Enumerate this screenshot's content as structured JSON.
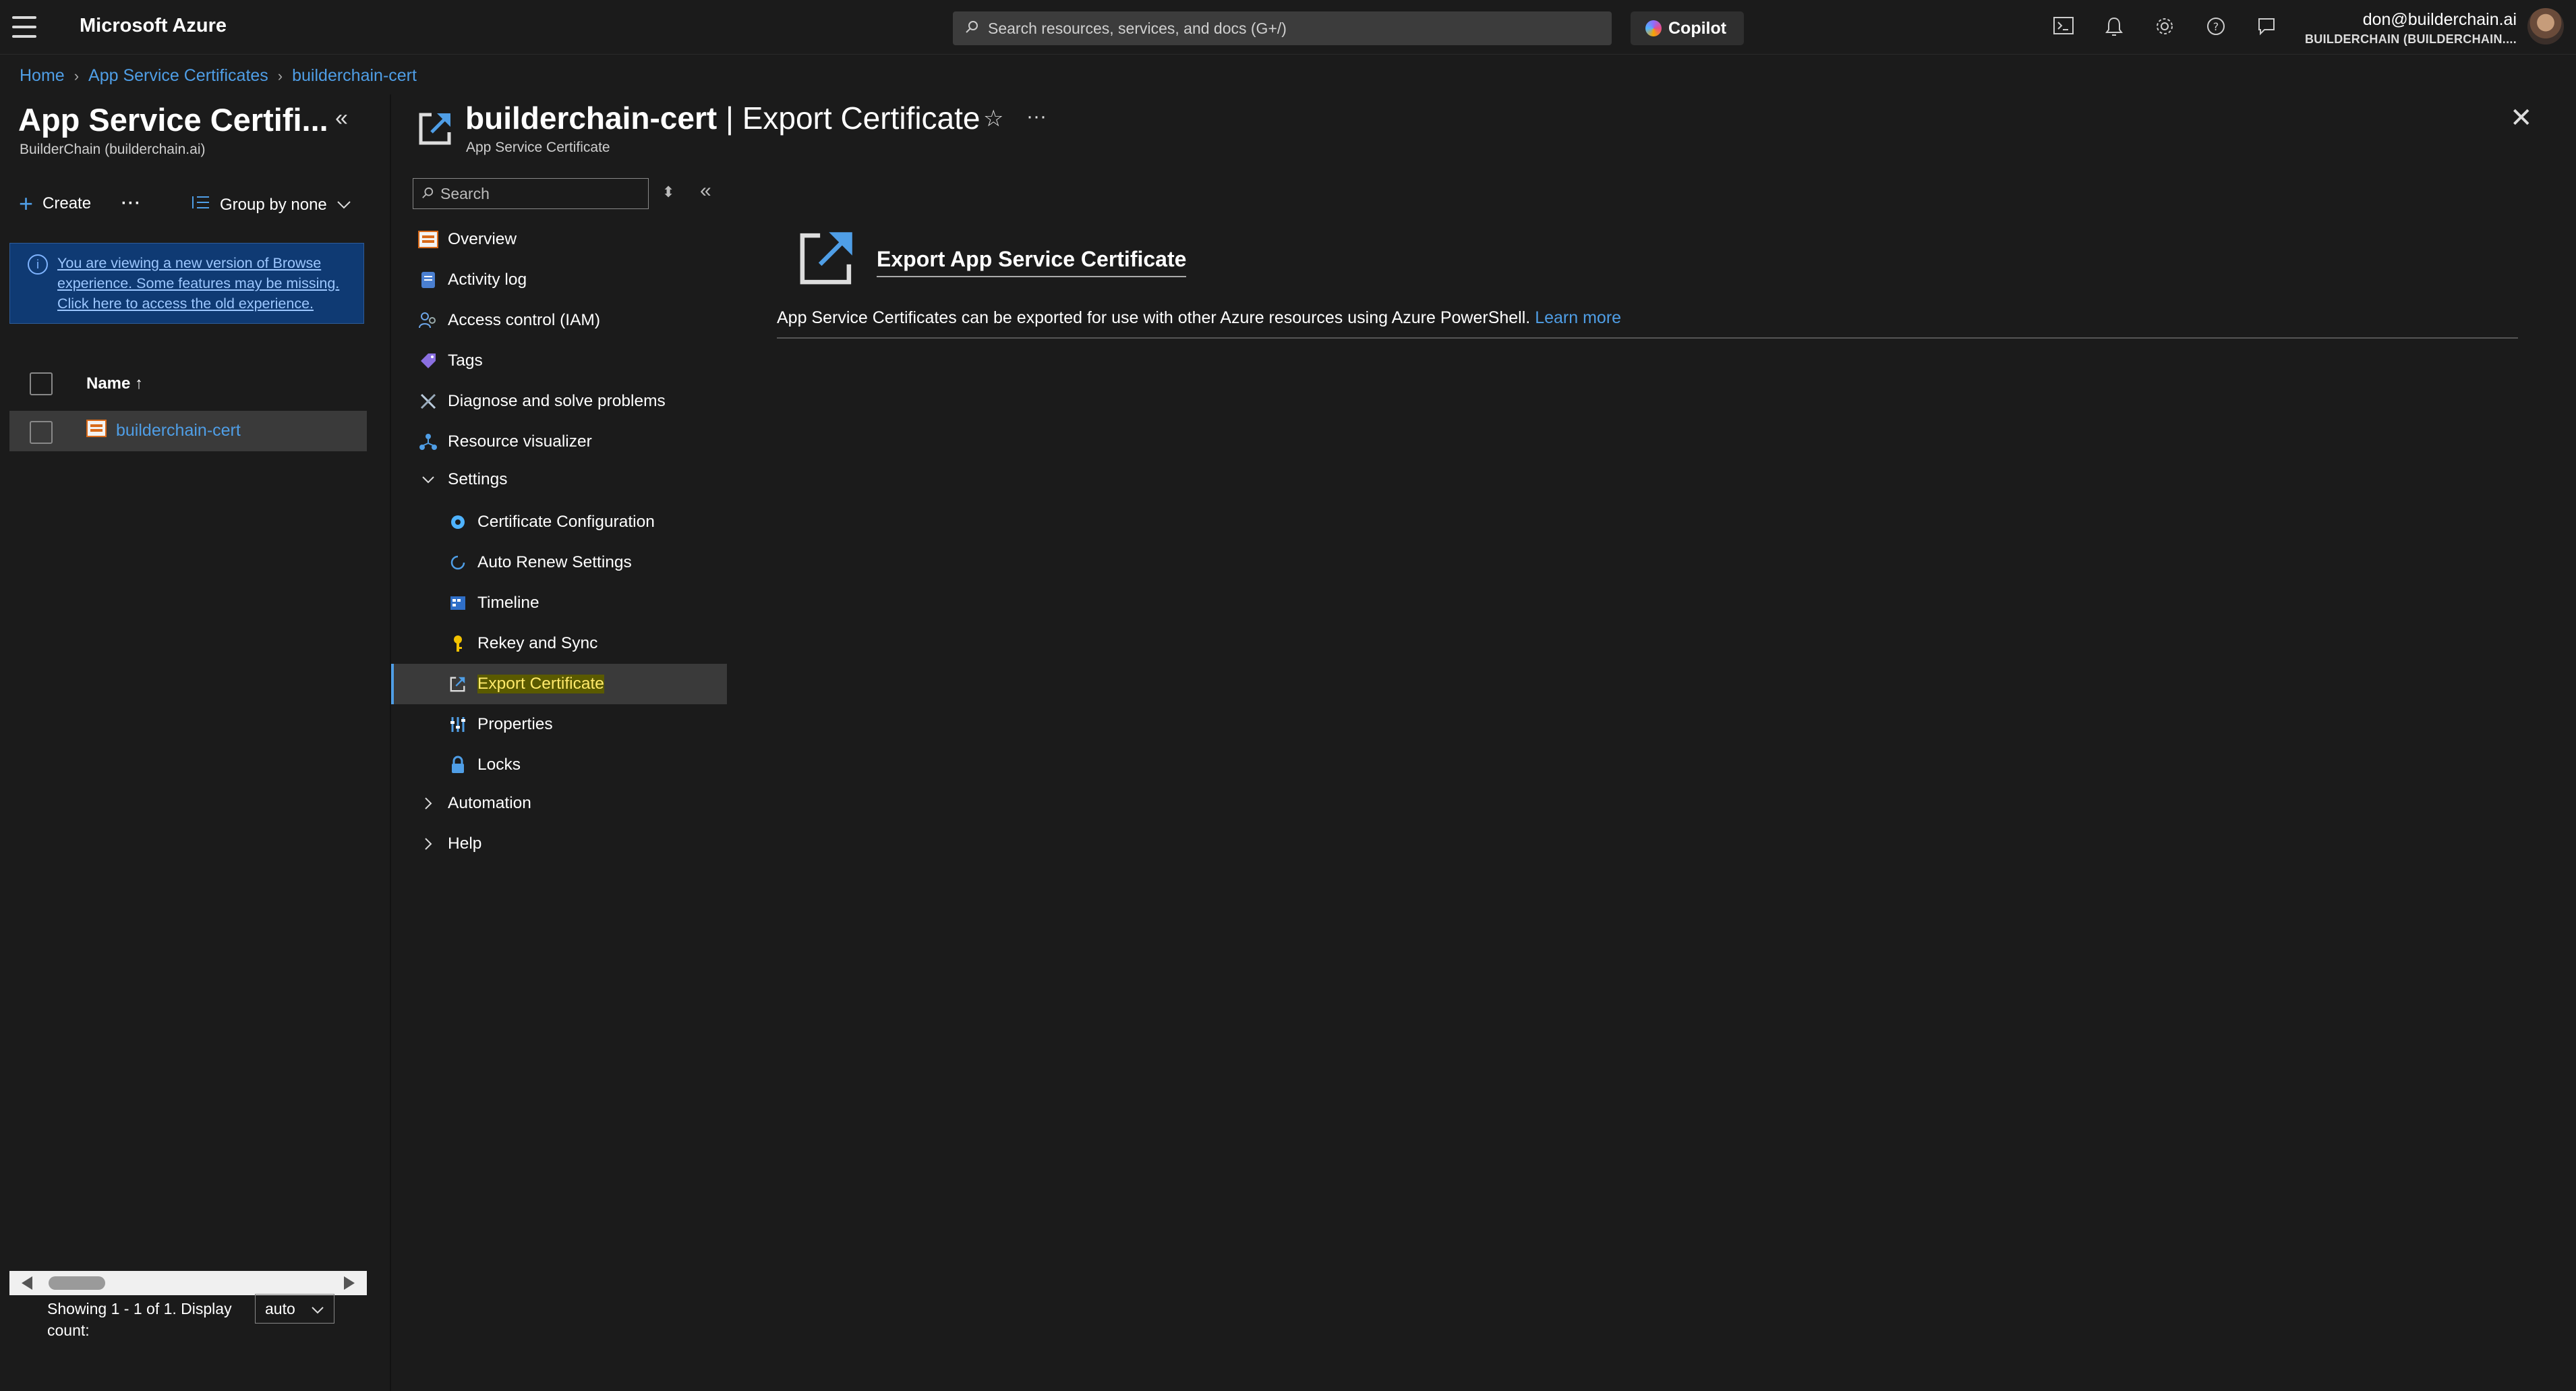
{
  "topbar": {
    "brand": "Microsoft Azure",
    "search_placeholder": "Search resources, services, and docs (G+/)",
    "copilot_label": "Copilot",
    "user_email": "don@builderchain.ai",
    "user_tenant": "BUILDERCHAIN (BUILDERCHAIN....",
    "icons": [
      "cloud-shell-icon",
      "bell-icon",
      "gear-icon",
      "help-icon",
      "feedback-icon"
    ]
  },
  "breadcrumb": [
    "Home",
    "App Service Certificates",
    "builderchain-cert"
  ],
  "left_pane": {
    "title": "App Service Certifi...",
    "subtitle": "BuilderChain (builderchain.ai)",
    "create_label": "Create",
    "more_label": "···",
    "group_by_label": "Group by none",
    "info_text": "You are viewing a new version of Browse experience. Some features may be missing. Click here to access the old experience.",
    "column_name": "Name ↑",
    "rows": [
      {
        "name": "builderchain-cert"
      }
    ],
    "footer_text": "Showing 1 - 1 of 1. Display count:",
    "display_count": "auto"
  },
  "resource": {
    "name": "builderchain-cert",
    "blade": "| Export Certificate",
    "type": "App Service Certificate"
  },
  "menu": {
    "search_placeholder": "Search",
    "items": [
      {
        "label": "Overview"
      },
      {
        "label": "Activity log"
      },
      {
        "label": "Access control (IAM)"
      },
      {
        "label": "Tags"
      },
      {
        "label": "Diagnose and solve problems"
      },
      {
        "label": "Resource visualizer"
      },
      {
        "label": "Settings"
      },
      {
        "label": "Certificate Configuration"
      },
      {
        "label": "Auto Renew Settings"
      },
      {
        "label": "Timeline"
      },
      {
        "label": "Rekey and Sync"
      },
      {
        "label": "Export Certificate"
      },
      {
        "label": "Properties"
      },
      {
        "label": "Locks"
      },
      {
        "label": "Automation"
      },
      {
        "label": "Help"
      }
    ]
  },
  "content": {
    "heading": "Export App Service Certificate",
    "description": "App Service Certificates can be exported for use with other Azure resources using Azure PowerShell.",
    "learn_more": "Learn more"
  },
  "colors": {
    "background": "#1b1b1b",
    "link": "#4f9ee6",
    "info_banner": "#0f3a73",
    "active_highlight": "#ffe96b"
  }
}
